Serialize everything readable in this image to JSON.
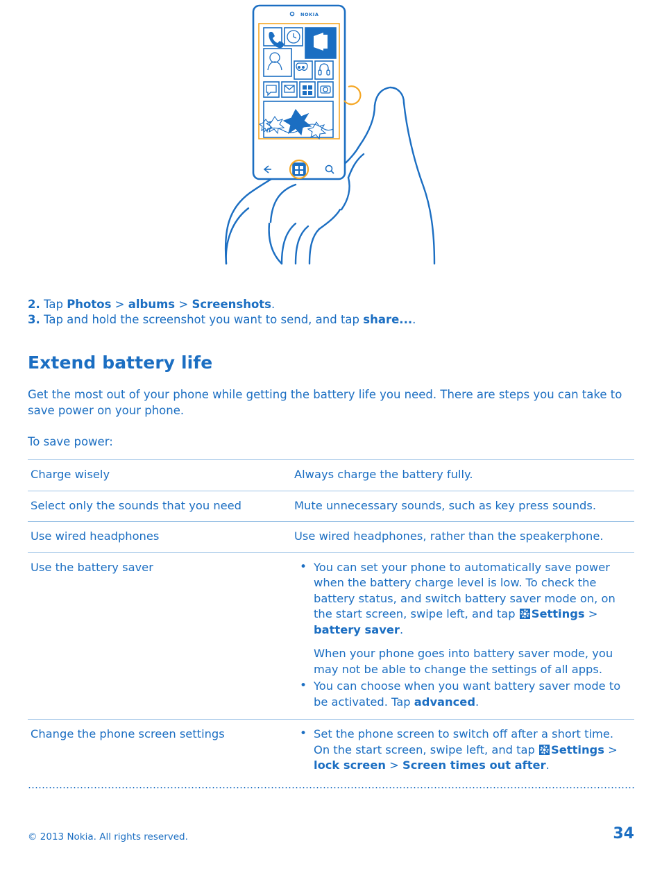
{
  "illustration": {
    "name": "hand-holding-lumia-phone-taking-screenshot",
    "brand_label": "NOKIA",
    "tiles": [
      "phone-icon",
      "clock-icon",
      "office-icon",
      "people-icon",
      "games-icon",
      "music-icon",
      "messaging-icon",
      "mail-icon",
      "store-icon",
      "camera-icon"
    ],
    "nav": [
      "back-icon",
      "windows-icon",
      "search-icon"
    ]
  },
  "steps": [
    {
      "num": "2.",
      "parts": [
        {
          "t": " Tap ",
          "b": false
        },
        {
          "t": "Photos",
          "b": true
        },
        {
          "t": " > ",
          "b": false
        },
        {
          "t": "albums",
          "b": true
        },
        {
          "t": " > ",
          "b": false
        },
        {
          "t": "Screenshots",
          "b": true
        },
        {
          "t": ".",
          "b": false
        }
      ]
    },
    {
      "num": "3.",
      "parts": [
        {
          "t": " Tap and hold the screenshot you want to send, and tap ",
          "b": false
        },
        {
          "t": "share...",
          "b": true
        },
        {
          "t": ".",
          "b": false
        }
      ]
    }
  ],
  "section": {
    "title": "Extend battery life",
    "intro": "Get the most out of your phone while getting the battery life you need. There are steps you can take to save power on your phone.",
    "lead": "To save power:"
  },
  "table": {
    "rows": [
      {
        "term": "Charge wisely",
        "type": "plain",
        "desc": "Always charge the battery fully."
      },
      {
        "term": "Select only the sounds that you need",
        "type": "plain",
        "desc": "Mute unnecessary sounds, such as key press sounds."
      },
      {
        "term": "Use wired headphones",
        "type": "plain",
        "desc": "Use wired headphones, rather than the speakerphone."
      },
      {
        "term": "Use the battery saver",
        "type": "bullets",
        "bullets": [
          {
            "bullet": true,
            "parts": [
              {
                "t": "You can set your phone to automatically save power when the battery charge level is low. To check the battery status, and switch battery saver mode on, on the start screen, swipe left, and tap ",
                "b": false
              },
              {
                "t": "gear-icon",
                "icon": true
              },
              {
                "t": "Settings",
                "b": true
              },
              {
                "t": " > ",
                "b": false
              },
              {
                "t": "battery saver",
                "b": true
              },
              {
                "t": ".",
                "b": false
              }
            ]
          },
          {
            "bullet": false,
            "parts": [
              {
                "t": "When your phone goes into battery saver mode, you may not be able to change the settings of all apps.",
                "b": false
              }
            ]
          },
          {
            "bullet": true,
            "parts": [
              {
                "t": "You can choose when you want battery saver mode to be activated. Tap ",
                "b": false
              },
              {
                "t": "advanced",
                "b": true
              },
              {
                "t": ".",
                "b": false
              }
            ]
          }
        ]
      },
      {
        "term": "Change the phone screen settings",
        "type": "bullets",
        "bullets": [
          {
            "bullet": true,
            "parts": [
              {
                "t": "Set the phone screen to switch off after a short time. On the start screen, swipe left, and tap ",
                "b": false
              },
              {
                "t": "gear-icon",
                "icon": true
              },
              {
                "t": "Settings",
                "b": true
              },
              {
                "t": " > ",
                "b": false
              },
              {
                "t": "lock screen",
                "b": true
              },
              {
                "t": " > ",
                "b": false
              },
              {
                "t": "Screen times out after",
                "b": true
              },
              {
                "t": ".",
                "b": false
              }
            ]
          }
        ]
      }
    ]
  },
  "footer": {
    "copyright": "© 2013 Nokia. All rights reserved.",
    "page": "34"
  },
  "colors": {
    "accent": "#1b6ec2",
    "rule": "#9dc3e6",
    "highlight": "#f5a623"
  }
}
